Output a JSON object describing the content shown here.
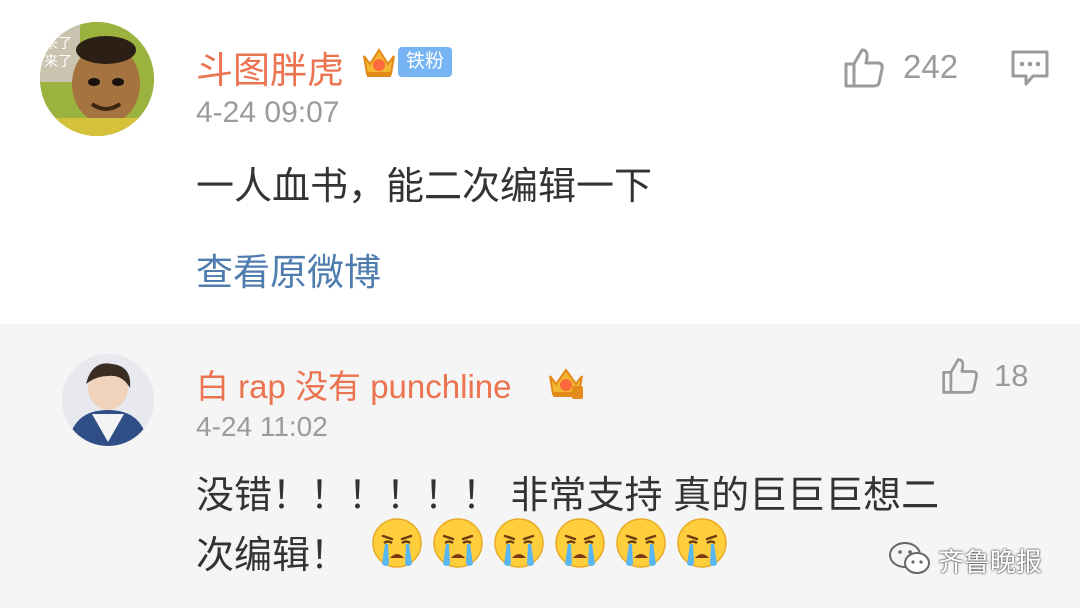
{
  "comments": [
    {
      "user": "斗图胖虎",
      "fan_badge": "铁粉",
      "avatar_caption": [
        "来了",
        "来了"
      ],
      "time": "4-24 09:07",
      "text": "一人血书，能二次编辑一下",
      "like_count": "242",
      "link_text": "查看原微博"
    },
    {
      "user": "白 rap 没有 punchline",
      "time": "4-24 11:02",
      "text_line1": "没错！！！！！！ 非常支持 真的巨巨巨想二",
      "text_line2": "次编辑！",
      "emoji_count": 6,
      "emoji_name": "crying-face-icon",
      "like_count": "18"
    }
  ],
  "watermark": "齐鲁晚报",
  "colors": {
    "username": "#eb7350",
    "link": "#507daf",
    "meta": "#9b9b9b",
    "fan_badge": "#77b4f3",
    "reply_background": "#f5f5f5"
  }
}
